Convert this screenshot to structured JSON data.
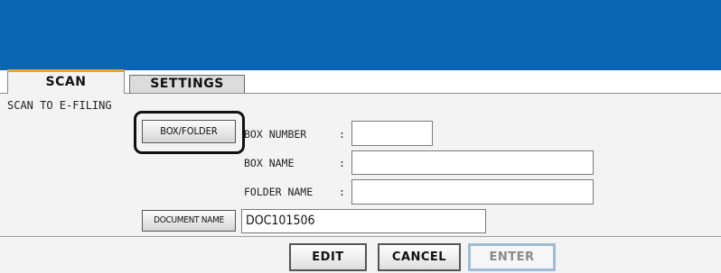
{
  "tabs": {
    "scan": "SCAN",
    "settings": "SETTINGS"
  },
  "section_title": "SCAN TO E-FILING",
  "buttons": {
    "box_folder": "BOX/FOLDER",
    "document_name": "DOCUMENT NAME",
    "edit": "EDIT",
    "cancel": "CANCEL",
    "enter": "ENTER"
  },
  "fields": {
    "box_number": {
      "label": "BOX NUMBER",
      "value": ""
    },
    "box_name": {
      "label": "BOX NAME",
      "value": ""
    },
    "folder_name": {
      "label": "FOLDER NAME",
      "value": ""
    },
    "document_name": {
      "value": "DOC101506"
    }
  },
  "separator": ":",
  "colors": {
    "header": "#0a64b4",
    "active_tab_accent": "#f0a030",
    "disabled_border": "#9fbcd6"
  }
}
